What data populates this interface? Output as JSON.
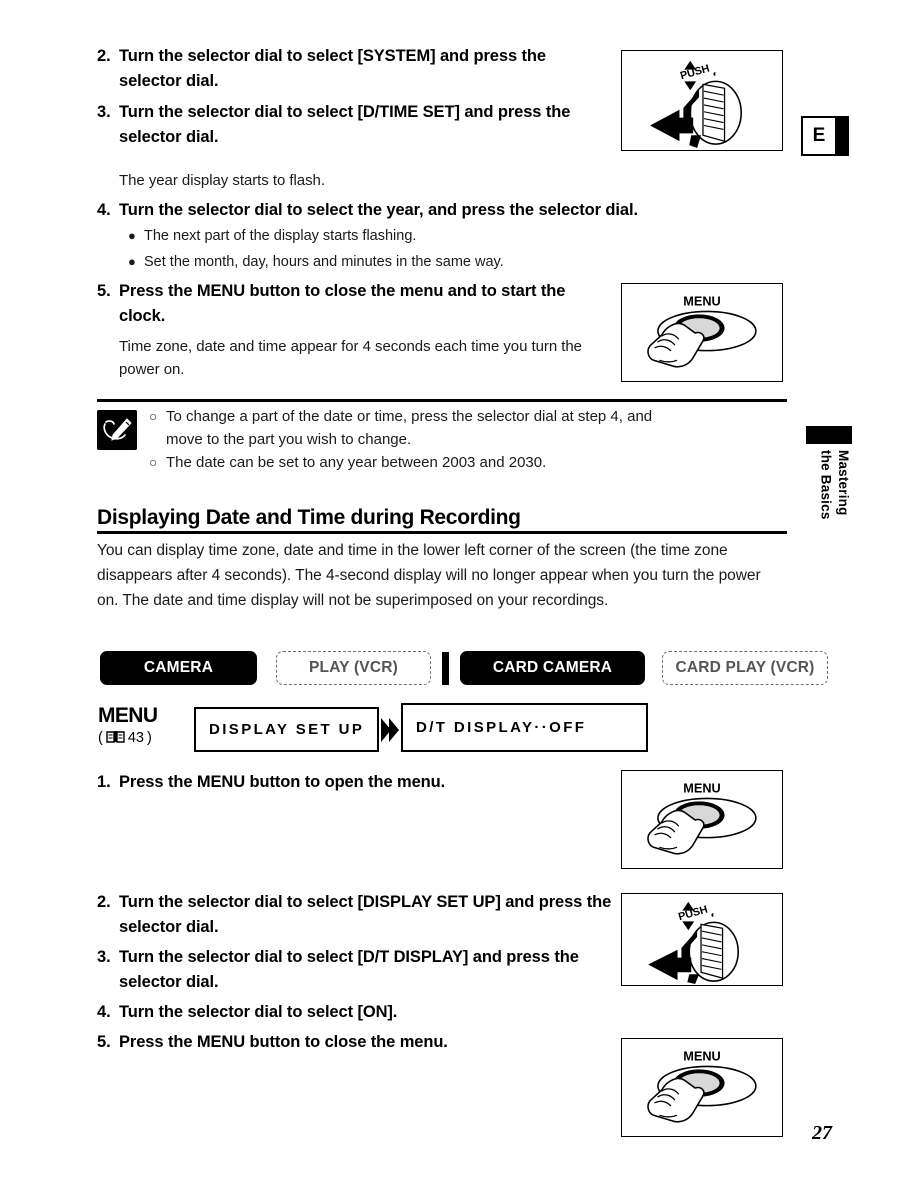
{
  "page": {
    "number": "27",
    "lang_tab": "E",
    "side_tab_label": "Mastering\nthe Basics"
  },
  "top_steps": [
    {
      "num": "2.",
      "text": "Turn the selector dial to select [SYSTEM] and press the selector dial."
    },
    {
      "num": "3.",
      "text": "Turn the selector dial to select [D/TIME SET] and press the selector dial."
    }
  ],
  "after_step3_note": "The year display starts to flash.",
  "step4": {
    "num": "4.",
    "text": "Turn the selector dial to select the year, and press the selector dial."
  },
  "step4_bullets": [
    "The next part of the display starts flashing.",
    "Set the month, day, hours and minutes in the same way."
  ],
  "step5": {
    "num": "5.",
    "text": "Press the MENU button to close the menu and to start the clock."
  },
  "after_step5_note": "Time zone, date and time appear for 4 seconds each time you turn the power on.",
  "notes": [
    {
      "line1": "To change a part of the date or time, press the selector dial at step 4, and",
      "line2": "move to the part you wish to change."
    },
    {
      "line1": "The date can be set to any year between 2003 and 2030.",
      "line2": ""
    }
  ],
  "section": {
    "heading": "Displaying Date and Time during Recording",
    "body": "You can display time zone, date and time in the lower left corner of the screen (the time zone disappears after 4 seconds). The 4-second display will no longer appear when you turn the power on. The date and time display will not be superimposed on your recordings."
  },
  "mode_badges": [
    {
      "label": "CAMERA",
      "style": "filled",
      "width": 157
    },
    {
      "label": "PLAY (VCR)",
      "style": "outline",
      "width": 155
    },
    {
      "label": "CARD CAMERA",
      "style": "filled",
      "width": 185
    },
    {
      "label": "CARD PLAY (VCR)",
      "style": "outline",
      "width": 166
    }
  ],
  "menu_path": {
    "menu_word": "MENU",
    "page_ref": "43",
    "book_icon": "open-book-icon",
    "box1": "DISPLAY SET UP",
    "arrow_icon": "double-chevron-right-icon",
    "box2": "D/T DISPLAY··OFF"
  },
  "bottom_steps": [
    {
      "num": "1.",
      "text": "Press the MENU button to open the menu."
    },
    {
      "num": "2.",
      "text": "Turn the selector dial to select [DISPLAY SET UP] and press the selector dial."
    },
    {
      "num": "3.",
      "text": "Turn the selector dial to select [D/T DISPLAY] and press the selector dial."
    },
    {
      "num": "4.",
      "text": "Turn the selector dial to select [ON]."
    },
    {
      "num": "5.",
      "text": "Press the MENU button to close the menu."
    }
  ],
  "illustrations": {
    "dial_label": "PUSH",
    "menu_label": "MENU"
  }
}
